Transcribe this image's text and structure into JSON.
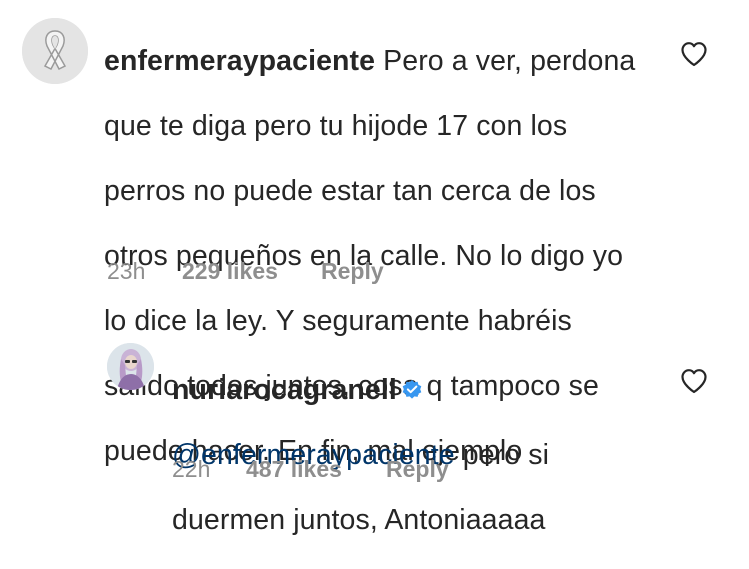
{
  "comments": [
    {
      "username": "enfermeraypaciente",
      "verified": false,
      "text_lines": [
        "Pero a ver, perdona",
        "que te diga pero tu hijode 17 con los",
        "perros no puede estar tan cerca de los",
        "otros pequeños en la calle. No lo digo yo",
        "lo dice la ley. Y seguramente habréis",
        "salido todos juntos, cosa q tampoco se",
        "puede hacer. En fin, mal ejemplo"
      ],
      "time": "23h",
      "likes": "229 likes",
      "reply_label": "Reply",
      "like_icon": "heart-outline-icon"
    },
    {
      "username": "nuriarocagranell",
      "verified": true,
      "mention": "@enfermeraypaciente",
      "text_lines": [
        "pero si",
        "duermen juntos, Antoniaaaaa"
      ],
      "time": "22h",
      "likes": "487 likes",
      "reply_label": "Reply",
      "like_icon": "heart-outline-icon"
    }
  ],
  "colors": {
    "text": "#262626",
    "secondary": "#8e8e8e",
    "mention": "#003569",
    "verified_badge": "#3897f0"
  }
}
